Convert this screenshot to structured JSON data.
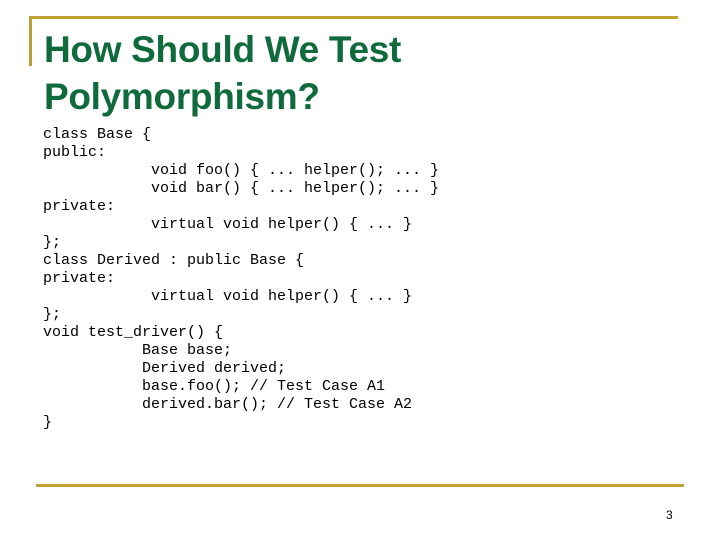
{
  "slide": {
    "title_lines": [
      "How Should We Test",
      "Polymorphism?"
    ],
    "page_number": "3",
    "colors": {
      "title": "#0f6a3c",
      "accent_rule": "#c0a033"
    },
    "code_lines": [
      {
        "text": "class Base {",
        "indent": 0
      },
      {
        "text": "public:",
        "indent": 0
      },
      {
        "text": "void foo() { ... helper(); ... }",
        "indent": 1
      },
      {
        "text": "void bar() { ... helper(); ... }",
        "indent": 1
      },
      {
        "text": "private:",
        "indent": 0
      },
      {
        "text": "virtual void helper() { ... }",
        "indent": 1
      },
      {
        "text": "};",
        "indent": 0
      },
      {
        "text": "class Derived : public Base {",
        "indent": 0
      },
      {
        "text": "private:",
        "indent": 0
      },
      {
        "text": "virtual void helper() { ... }",
        "indent": 1
      },
      {
        "text": "};",
        "indent": 0
      },
      {
        "text": "void test_driver() {",
        "indent": 0
      },
      {
        "text": "Base base;",
        "indent": 2
      },
      {
        "text": "Derived derived;",
        "indent": 2
      },
      {
        "text": "base.foo(); // Test Case A1",
        "indent": 2
      },
      {
        "text": "derived.bar(); // Test Case A2",
        "indent": 2
      },
      {
        "text": "}",
        "indent": 0
      }
    ]
  }
}
